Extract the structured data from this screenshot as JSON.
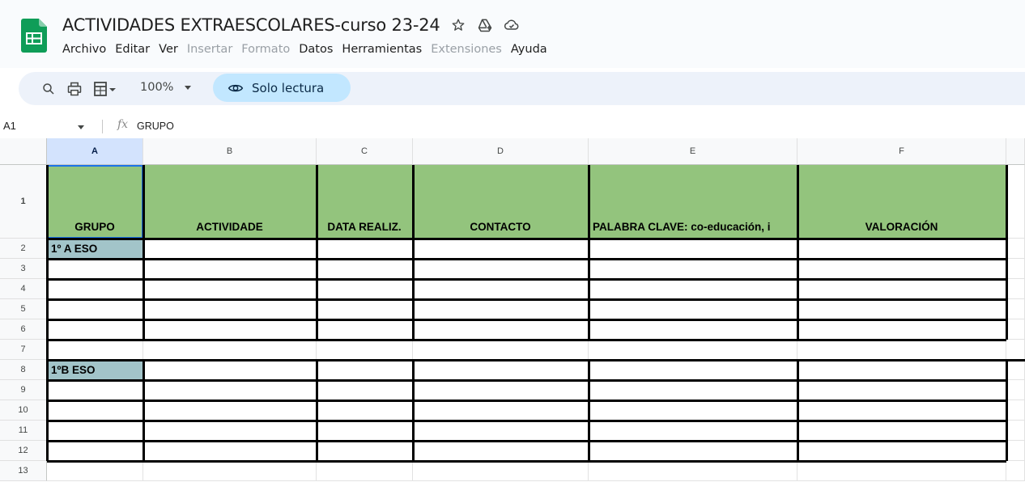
{
  "app": {
    "title": "ACTIVIDADES EXTRAESCOLARES-curso 23-24",
    "title_icons": [
      "star-icon",
      "move-to-drive-icon",
      "cloud-saved-icon"
    ],
    "brand_color": "#0f9d58"
  },
  "menu": {
    "items": [
      {
        "label": "Archivo",
        "disabled": false
      },
      {
        "label": "Editar",
        "disabled": false
      },
      {
        "label": "Ver",
        "disabled": false
      },
      {
        "label": "Insertar",
        "disabled": true
      },
      {
        "label": "Formato",
        "disabled": true
      },
      {
        "label": "Datos",
        "disabled": false
      },
      {
        "label": "Herramientas",
        "disabled": false
      },
      {
        "label": "Extensiones",
        "disabled": true
      },
      {
        "label": "Ayuda",
        "disabled": false
      }
    ]
  },
  "toolbar": {
    "icons": [
      "search-icon",
      "print-icon",
      "format-icon"
    ],
    "zoom": "100%",
    "readonly_label": "Solo lectura"
  },
  "formula_bar": {
    "cell_ref": "A1",
    "fx": "fx",
    "content": "GRUPO"
  },
  "sheet": {
    "columns": [
      "A",
      "B",
      "C",
      "D",
      "E",
      "F"
    ],
    "rows": [
      "1",
      "2",
      "3",
      "4",
      "5",
      "6",
      "7",
      "8",
      "9",
      "10",
      "11",
      "12",
      "13"
    ],
    "header_row": [
      "GRUPO",
      "ACTIVIDADE",
      "DATA REALIZ.",
      "CONTACTO",
      "PALABRA CLAVE: co-educación, i",
      "VALORACIÓN"
    ],
    "groups": [
      {
        "row": "2",
        "label": "1º A ESO"
      },
      {
        "row": "8",
        "label": "1ºB ESO"
      }
    ],
    "selected_cell": "A1",
    "header_color": "#93c47d",
    "group_color": "#a2c4c9"
  }
}
